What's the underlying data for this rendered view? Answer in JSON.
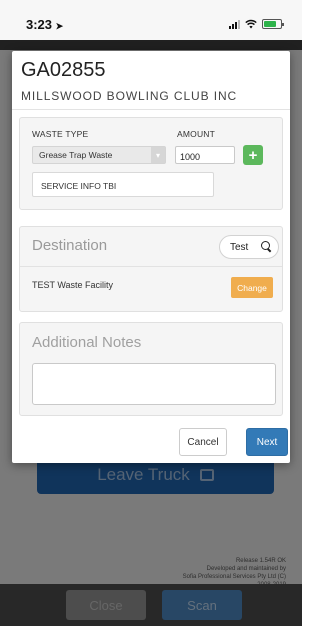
{
  "status_bar": {
    "time": "3:23",
    "location_icon": "location-arrow-icon",
    "signal_icon": "cellular-signal-icon",
    "wifi_icon": "wifi-icon",
    "battery_icon": "battery-charging-icon",
    "battery_level": 0.75
  },
  "background": {
    "leave_truck_label": "Leave Truck",
    "leave_truck_icon": "exit-door-icon",
    "release_text": "Release 1.54R OK",
    "credit_line1": "Developed and maintained by",
    "credit_line2": "Sofia Professional Services Pty Ltd (C)",
    "credit_line3": "2008-2019",
    "close_label": "Close",
    "scan_label": "Scan"
  },
  "modal": {
    "job_id": "GA02855",
    "client_name": "MILLSWOOD BOWLING CLUB INC",
    "waste": {
      "waste_type_label": "WASTE TYPE",
      "waste_type_value": "Grease Trap Waste",
      "amount_label": "AMOUNT",
      "amount_value": "1000",
      "add_label": "+",
      "service_info": "SERVICE INFO TBI"
    },
    "destination": {
      "title": "Destination",
      "search_value": "Test",
      "facility": "TEST Waste Facility",
      "change_label": "Change"
    },
    "notes": {
      "title": "Additional Notes",
      "value": ""
    },
    "cancel_label": "Cancel",
    "next_label": "Next"
  },
  "colors": {
    "primary": "#337ab7",
    "success": "#5cb85c",
    "warning": "#f0ad4e"
  }
}
